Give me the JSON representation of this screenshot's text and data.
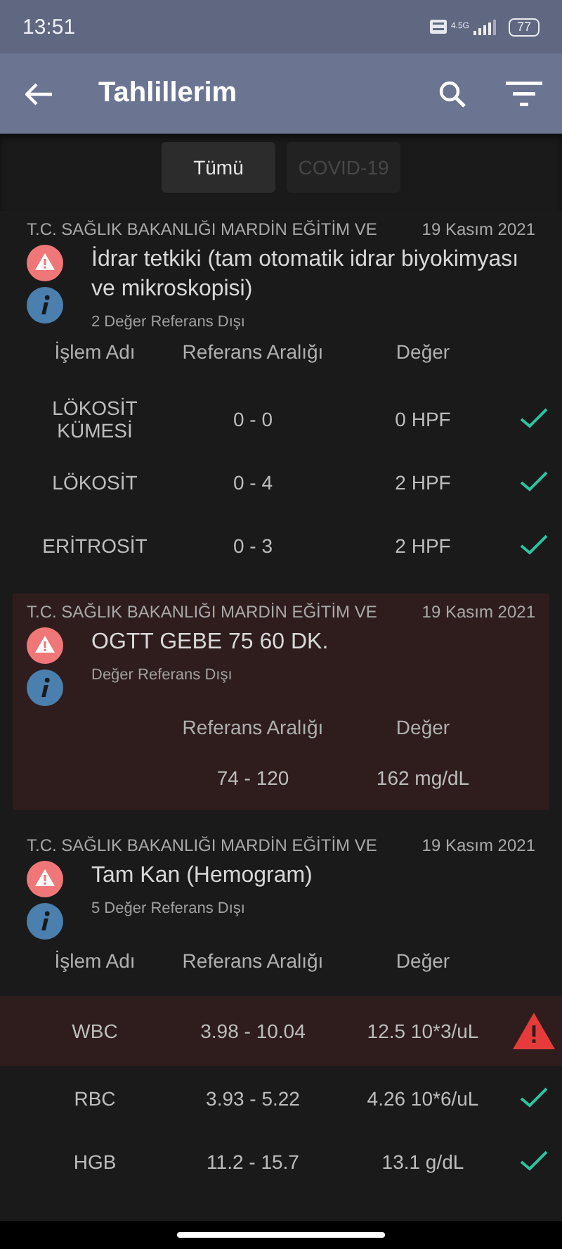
{
  "status_bar": {
    "time": "13:51",
    "network": "4.5G",
    "battery": "77"
  },
  "app_bar": {
    "title": "Tahlillerim"
  },
  "tabs": [
    {
      "label": "Tümü",
      "selected": true
    },
    {
      "label": "COVID-19",
      "selected": false
    }
  ],
  "results": [
    {
      "institution": "T.C. SAĞLIK BAKANLIĞI MARDİN EĞİTİM VE",
      "date": "19 Kasım 2021",
      "title": "İdrar tetkiki (tam otomatik idrar biyokimyası ve mikroskopisi)",
      "summary": "2 Değer Referans Dışı",
      "out_of_range": false,
      "columns": {
        "name": "İşlem Adı",
        "range": "Referans Aralığı",
        "value": "Değer"
      },
      "rows": [
        {
          "name": "LÖKOSİT KÜMESİ",
          "range": "0 - 0",
          "value": "0 HPF",
          "kind": "normal"
        },
        {
          "name": "LÖKOSİT",
          "range": "0 - 4",
          "value": "2 HPF",
          "kind": "normal"
        },
        {
          "name": "ERİTROSİT",
          "range": "0 - 3",
          "value": "2 HPF",
          "kind": "normal"
        }
      ]
    },
    {
      "institution": "T.C. SAĞLIK BAKANLIĞI MARDİN EĞİTİM VE",
      "date": "19 Kasım 2021",
      "title": "OGTT GEBE 75 60 DK.",
      "summary": "Değer Referans Dışı",
      "out_of_range": true,
      "columns": {
        "range": "Referans Aralığı",
        "value": "Değer"
      },
      "rows": [
        {
          "range": "74 - 120",
          "value": "162 mg/dL"
        }
      ]
    },
    {
      "institution": "T.C. SAĞLIK BAKANLIĞI MARDİN EĞİTİM VE",
      "date": "19 Kasım 2021",
      "title": "Tam Kan (Hemogram)",
      "summary": "5 Değer Referans Dışı",
      "out_of_range": false,
      "columns": {
        "name": "İşlem Adı",
        "range": "Referans Aralığı",
        "value": "Değer"
      },
      "rows": [
        {
          "name": "WBC",
          "range": "3.98 - 10.04",
          "value": "12.5 10*3/uL",
          "kind": "high"
        },
        {
          "name": "RBC",
          "range": "3.93 - 5.22",
          "value": "4.26 10*6/uL",
          "kind": "normal"
        },
        {
          "name": "HGB",
          "range": "11.2 - 15.7",
          "value": "13.1 g/dL",
          "kind": "normal"
        }
      ]
    }
  ]
}
